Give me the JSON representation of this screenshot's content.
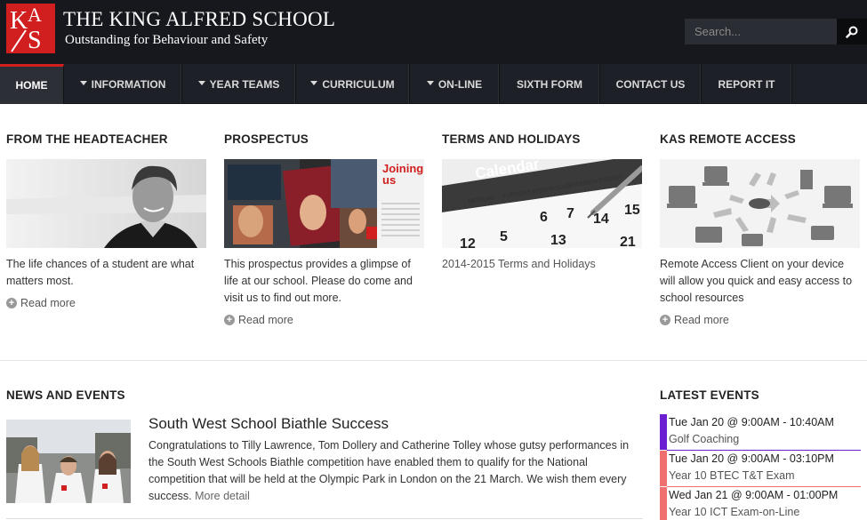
{
  "header": {
    "logo_text": "KAS",
    "school_name": "THE KING ALFRED SCHOOL",
    "tagline": "Outstanding for Behaviour and Safety",
    "search_placeholder": "Search...",
    "search_icon": "search-icon"
  },
  "nav": {
    "items": [
      {
        "label": "HOME",
        "active": true,
        "dropdown": false
      },
      {
        "label": "INFORMATION",
        "active": false,
        "dropdown": true
      },
      {
        "label": "YEAR TEAMS",
        "active": false,
        "dropdown": true
      },
      {
        "label": "CURRICULUM",
        "active": false,
        "dropdown": true
      },
      {
        "label": "ON-LINE",
        "active": false,
        "dropdown": true
      },
      {
        "label": "SIXTH FORM",
        "active": false,
        "dropdown": false
      },
      {
        "label": "CONTACT US",
        "active": false,
        "dropdown": false
      },
      {
        "label": "REPORT IT",
        "active": false,
        "dropdown": false
      }
    ]
  },
  "features": [
    {
      "title": "FROM THE HEADTEACHER",
      "text": "The life chances of a student are what matters most.",
      "read_more": "Read more"
    },
    {
      "title": "PROSPECTUS",
      "text": "This prospectus provides a glimpse of life at our school. Please do come and visit us to find out more.",
      "read_more": "Read more",
      "image_text": "Joining us"
    },
    {
      "title": "TERMS AND HOLIDAYS",
      "text": "2014-2015 Terms and Holidays",
      "image_text": "Calendar"
    },
    {
      "title": "KAS REMOTE ACCESS",
      "text": "Remote Access Client on your device will allow you quick and easy access to school resources",
      "read_more": "Read more"
    }
  ],
  "news": {
    "section_title": "NEWS AND EVENTS",
    "title": "South West School Biathle Success",
    "body": "Congratulations to Tilly Lawrence, Tom Dollery and Catherine Tolley whose gutsy performances in the South West Schools Biathle competition have enabled them to qualify for the National competition that will be held at the Olympic Park in London on the 21 March. We wish them every success.",
    "more_detail": "More detail"
  },
  "events": {
    "section_title": "LATEST EVENTS",
    "items": [
      {
        "when": "Tue Jan 20 @ 9:00AM - 10:40AM",
        "what": "Golf Coaching",
        "color": "#6a1fd1"
      },
      {
        "when": "Tue Jan 20 @ 9:00AM - 03:10PM",
        "what": "Year 10 BTEC T&T Exam",
        "color": "#f07070"
      },
      {
        "when": "Wed Jan 21 @ 9:00AM - 01:00PM",
        "what": "Year 10 ICT Exam-on-Line",
        "color": "#f07070"
      }
    ]
  },
  "colors": {
    "brand_red": "#d11f1f",
    "header_bg": "#16181d",
    "nav_bg": "#1d2026"
  }
}
